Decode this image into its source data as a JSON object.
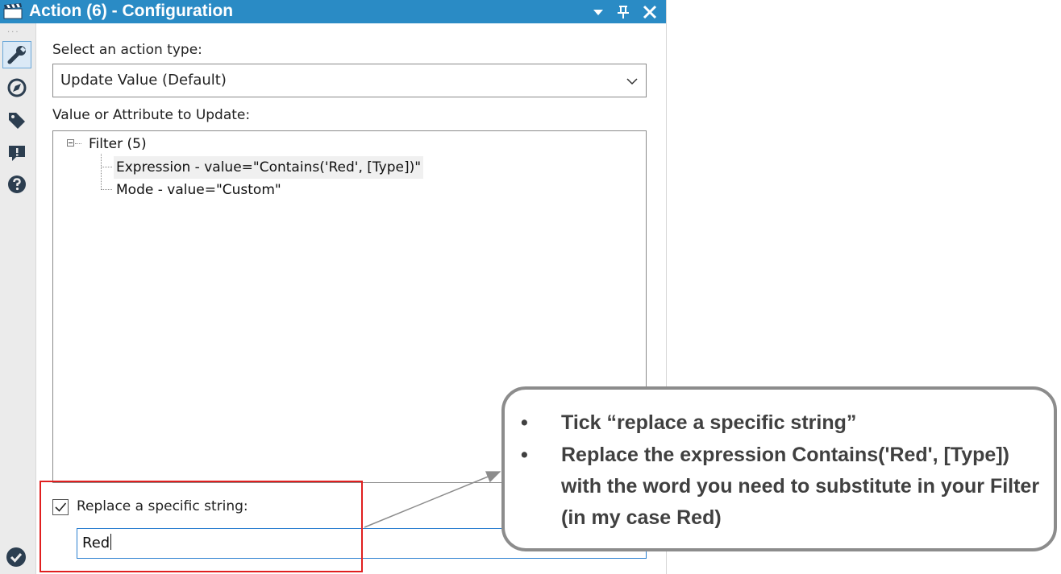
{
  "window": {
    "title": "Action (6) - Configuration",
    "title_color": "#2a8bc5"
  },
  "rail": {
    "items": [
      {
        "icon": "wrench-icon",
        "active": true
      },
      {
        "icon": "compass-icon",
        "active": false
      },
      {
        "icon": "tag-icon",
        "active": false
      },
      {
        "icon": "alert-icon",
        "active": false
      },
      {
        "icon": "help-icon",
        "active": false
      }
    ],
    "status_icon": "check-circle-icon"
  },
  "form": {
    "action_type_label": "Select an action type:",
    "action_type_value": "Update Value (Default)",
    "tree_label": "Value or Attribute to Update:",
    "tree": {
      "root": "Filter (5)",
      "children": [
        "Expression - value=\"Contains('Red', [Type])\"",
        "Mode - value=\"Custom\""
      ]
    },
    "replace_checkbox_label": "Replace a specific string:",
    "replace_checked": true,
    "replace_value": "Red"
  },
  "callout": {
    "bullets": [
      "Tick “replace a specific string”",
      "Replace the expression Contains('Red', [Type]) with the word you need to substitute in your Filter (in my case Red)"
    ],
    "bullet_char": "•",
    "highlight_color": "#e01f1f"
  }
}
